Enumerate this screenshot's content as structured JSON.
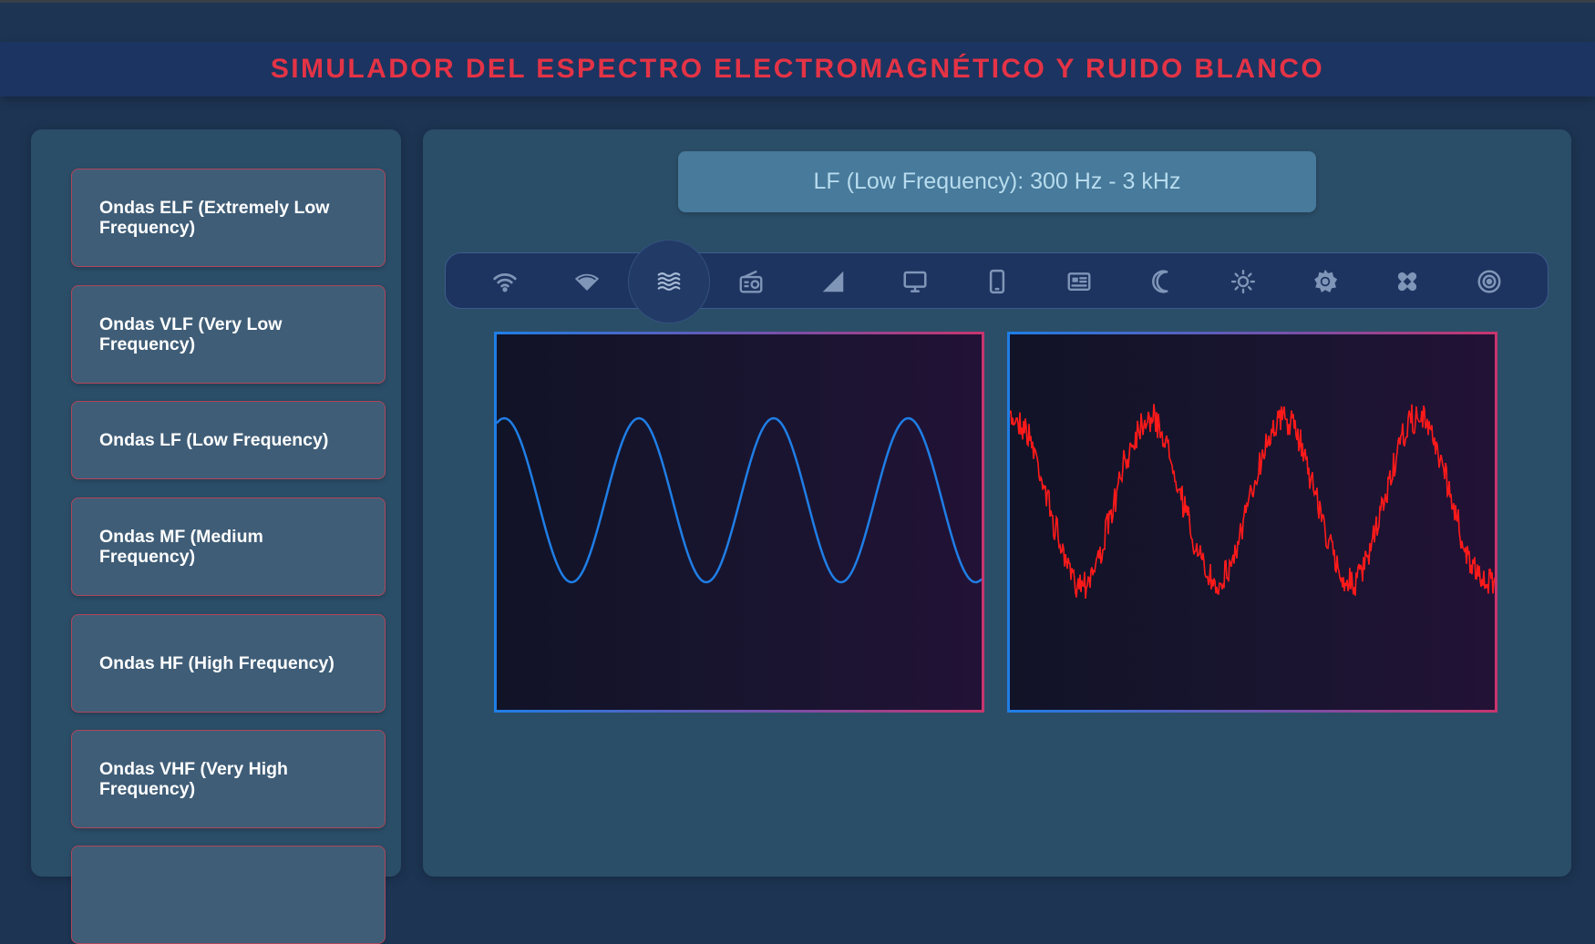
{
  "header": {
    "title": "SIMULADOR DEL ESPECTRO ELECTROMAGNÉTICO Y RUIDO BLANCO"
  },
  "sidebar": {
    "items": [
      {
        "label": "Ondas ELF (Extremely Low Frequency)"
      },
      {
        "label": "Ondas VLF (Very Low Frequency)"
      },
      {
        "label": "Ondas LF (Low Frequency)"
      },
      {
        "label": "Ondas MF (Medium Frequency)"
      },
      {
        "label": "Ondas HF (High Frequency)"
      },
      {
        "label": "Ondas VHF (Very High Frequency)"
      },
      {
        "label": ""
      }
    ]
  },
  "main": {
    "frequency_display": "LF (Low Frequency): 300 Hz - 3 kHz",
    "icons": [
      {
        "name": "wifi-icon"
      },
      {
        "name": "wifi-filled-icon"
      },
      {
        "name": "waves-icon",
        "active": true
      },
      {
        "name": "radio-icon"
      },
      {
        "name": "signal-icon"
      },
      {
        "name": "monitor-icon"
      },
      {
        "name": "smartphone-icon"
      },
      {
        "name": "news-icon"
      },
      {
        "name": "moon-icon"
      },
      {
        "name": "sun-icon"
      },
      {
        "name": "sun-filled-icon"
      },
      {
        "name": "bandage-icon"
      },
      {
        "name": "radar-icon"
      }
    ],
    "clean_wave": {
      "color": "#1f7ee6",
      "cycles": 3.6
    },
    "noisy_wave": {
      "color": "#ff1a1a",
      "cycles": 3.6
    }
  }
}
